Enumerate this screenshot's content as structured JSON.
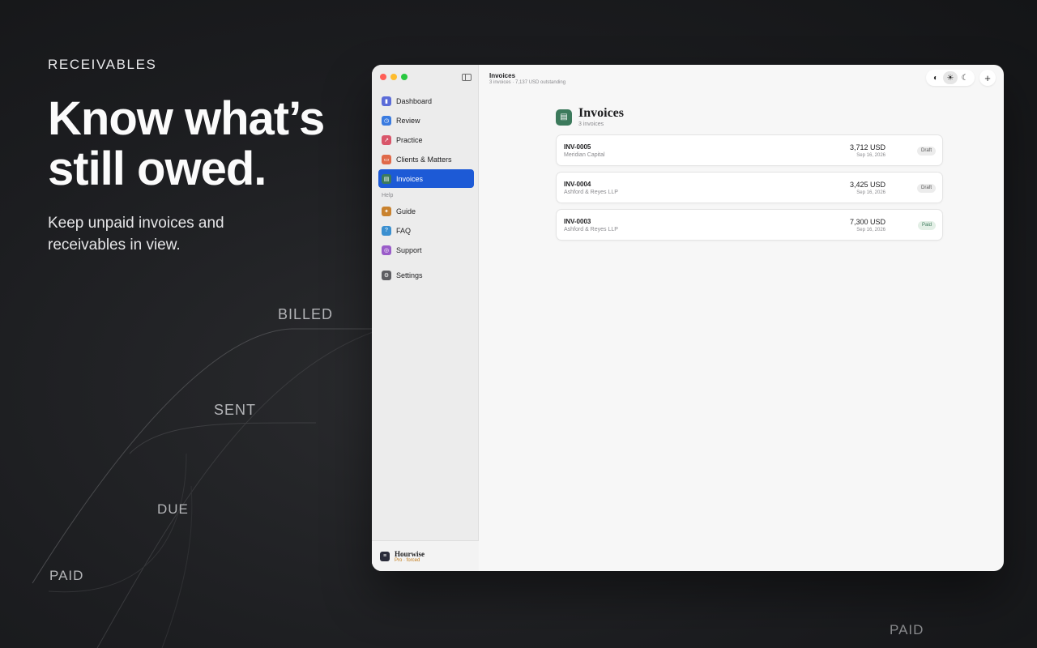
{
  "marketing": {
    "eyebrow": "RECEIVABLES",
    "headline_line1": "Know what’s",
    "headline_line2": "still owed.",
    "subhead_line1": "Keep unpaid invoices and",
    "subhead_line2": "receivables in view."
  },
  "stages": {
    "billed": "BILLED",
    "sent": "SENT",
    "due": "DUE",
    "paid": "PAID",
    "paid_corner": "PAID"
  },
  "sidebar": {
    "items": [
      {
        "label": "Dashboard",
        "icon": "chart-icon",
        "color": "#5b6cd8"
      },
      {
        "label": "Review",
        "icon": "clock-icon",
        "color": "#3a7be0"
      },
      {
        "label": "Practice",
        "icon": "trend-icon",
        "color": "#d9566a"
      },
      {
        "label": "Clients & Matters",
        "icon": "folder-icon",
        "color": "#e06a4a"
      },
      {
        "label": "Invoices",
        "icon": "document-icon",
        "color": "#3c7a5c",
        "active": true
      }
    ],
    "help_section": "Help",
    "help_items": [
      {
        "label": "Guide",
        "icon": "compass-icon",
        "color": "#c9822e"
      },
      {
        "label": "FAQ",
        "icon": "question-icon",
        "color": "#3a8fd0"
      },
      {
        "label": "Support",
        "icon": "lifebuoy-icon",
        "color": "#9a5cc9"
      }
    ],
    "settings": {
      "label": "Settings",
      "icon": "gear-icon",
      "color": "#5e5e62"
    },
    "brand": {
      "name": "Hourwise",
      "plan": "Pro · forced"
    }
  },
  "toolbar": {
    "title": "Invoices",
    "subtitle": "3 invoices · 7,137 USD outstanding",
    "theme_auto": "◐",
    "theme_light": "☀",
    "theme_dark": "☾",
    "add": "+"
  },
  "page": {
    "title": "Invoices",
    "count": "3 invoices"
  },
  "invoices": [
    {
      "id": "INV-0005",
      "client": "Meridian Capital",
      "amount": "3,712 USD",
      "date": "Sep 16, 2026",
      "status": "Draft"
    },
    {
      "id": "INV-0004",
      "client": "Ashford & Reyes LLP",
      "amount": "3,425 USD",
      "date": "Sep 16, 2026",
      "status": "Draft"
    },
    {
      "id": "INV-0003",
      "client": "Ashford & Reyes LLP",
      "amount": "7,300 USD",
      "date": "Sep 16, 2026",
      "status": "Paid"
    }
  ]
}
